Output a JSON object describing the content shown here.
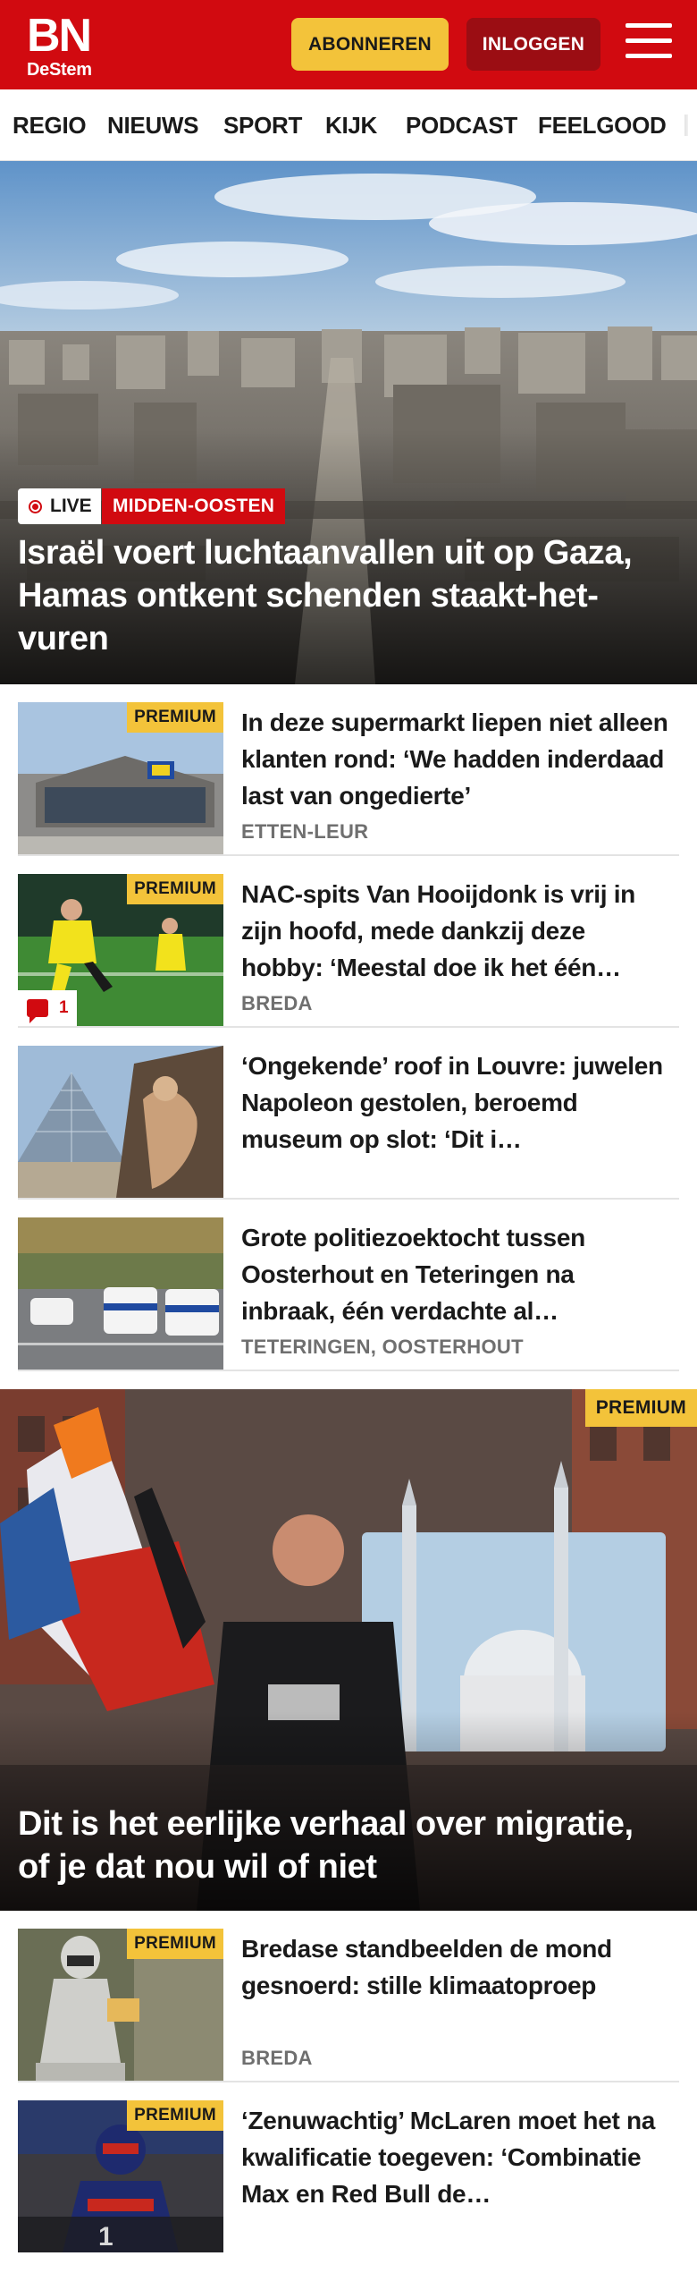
{
  "header": {
    "logo_main": "BN",
    "logo_sub": "DeStem",
    "subscribe_label": "ABONNEREN",
    "login_label": "INLOGGEN",
    "menu_icon": "hamburger-menu-icon",
    "brand_color": "#d10a10",
    "accent_color": "#f3c33a"
  },
  "nav": {
    "items": [
      "REGIO",
      "NIEUWS",
      "SPORT",
      "KIJK",
      "PODCAST",
      "FEELGOOD"
    ]
  },
  "hero": {
    "live_label": "LIVE",
    "topic_label": "MIDDEN-OOSTEN",
    "title": "Israël voert luchtaanvallen uit op Gaza, Hamas ontkent schenden staakt-het-vuren"
  },
  "articles_top": [
    {
      "premium": "PREMIUM",
      "title": "In deze supermarkt liepen niet alleen klanten rond: ‘We hadden inderdaad last van ongedierte’",
      "location": "ETTEN-LEUR"
    },
    {
      "premium": "PREMIUM",
      "comments": "1",
      "title": "NAC-spits Van Hooijdonk is vrij in zijn hoofd, mede dankzij deze hobby: ‘Meestal doe ik het één…",
      "location": "BREDA"
    },
    {
      "title": "‘Ongekende’ roof in Louvre: juwelen Napoleon gestolen, beroemd museum op slot: ‘Dit i…"
    },
    {
      "title": "Grote politiezoektocht tussen Oosterhout en Teteringen na inbraak, één verdachte al…",
      "location": "TETERINGEN, OOSTERHOUT"
    }
  ],
  "feature": {
    "premium": "PREMIUM",
    "title": "Dit is het eerlijke verhaal over migratie, of je dat nou wil of niet"
  },
  "articles_bottom": [
    {
      "premium": "PREMIUM",
      "title": "Bredase standbeelden de mond gesnoerd: stille klimaatoproep",
      "location": "BREDA"
    },
    {
      "premium": "PREMIUM",
      "title": "‘Zenuwachtig’ McLaren moet het na kwalificatie toegeven: ‘Combinatie Max en Red Bull de…"
    }
  ]
}
